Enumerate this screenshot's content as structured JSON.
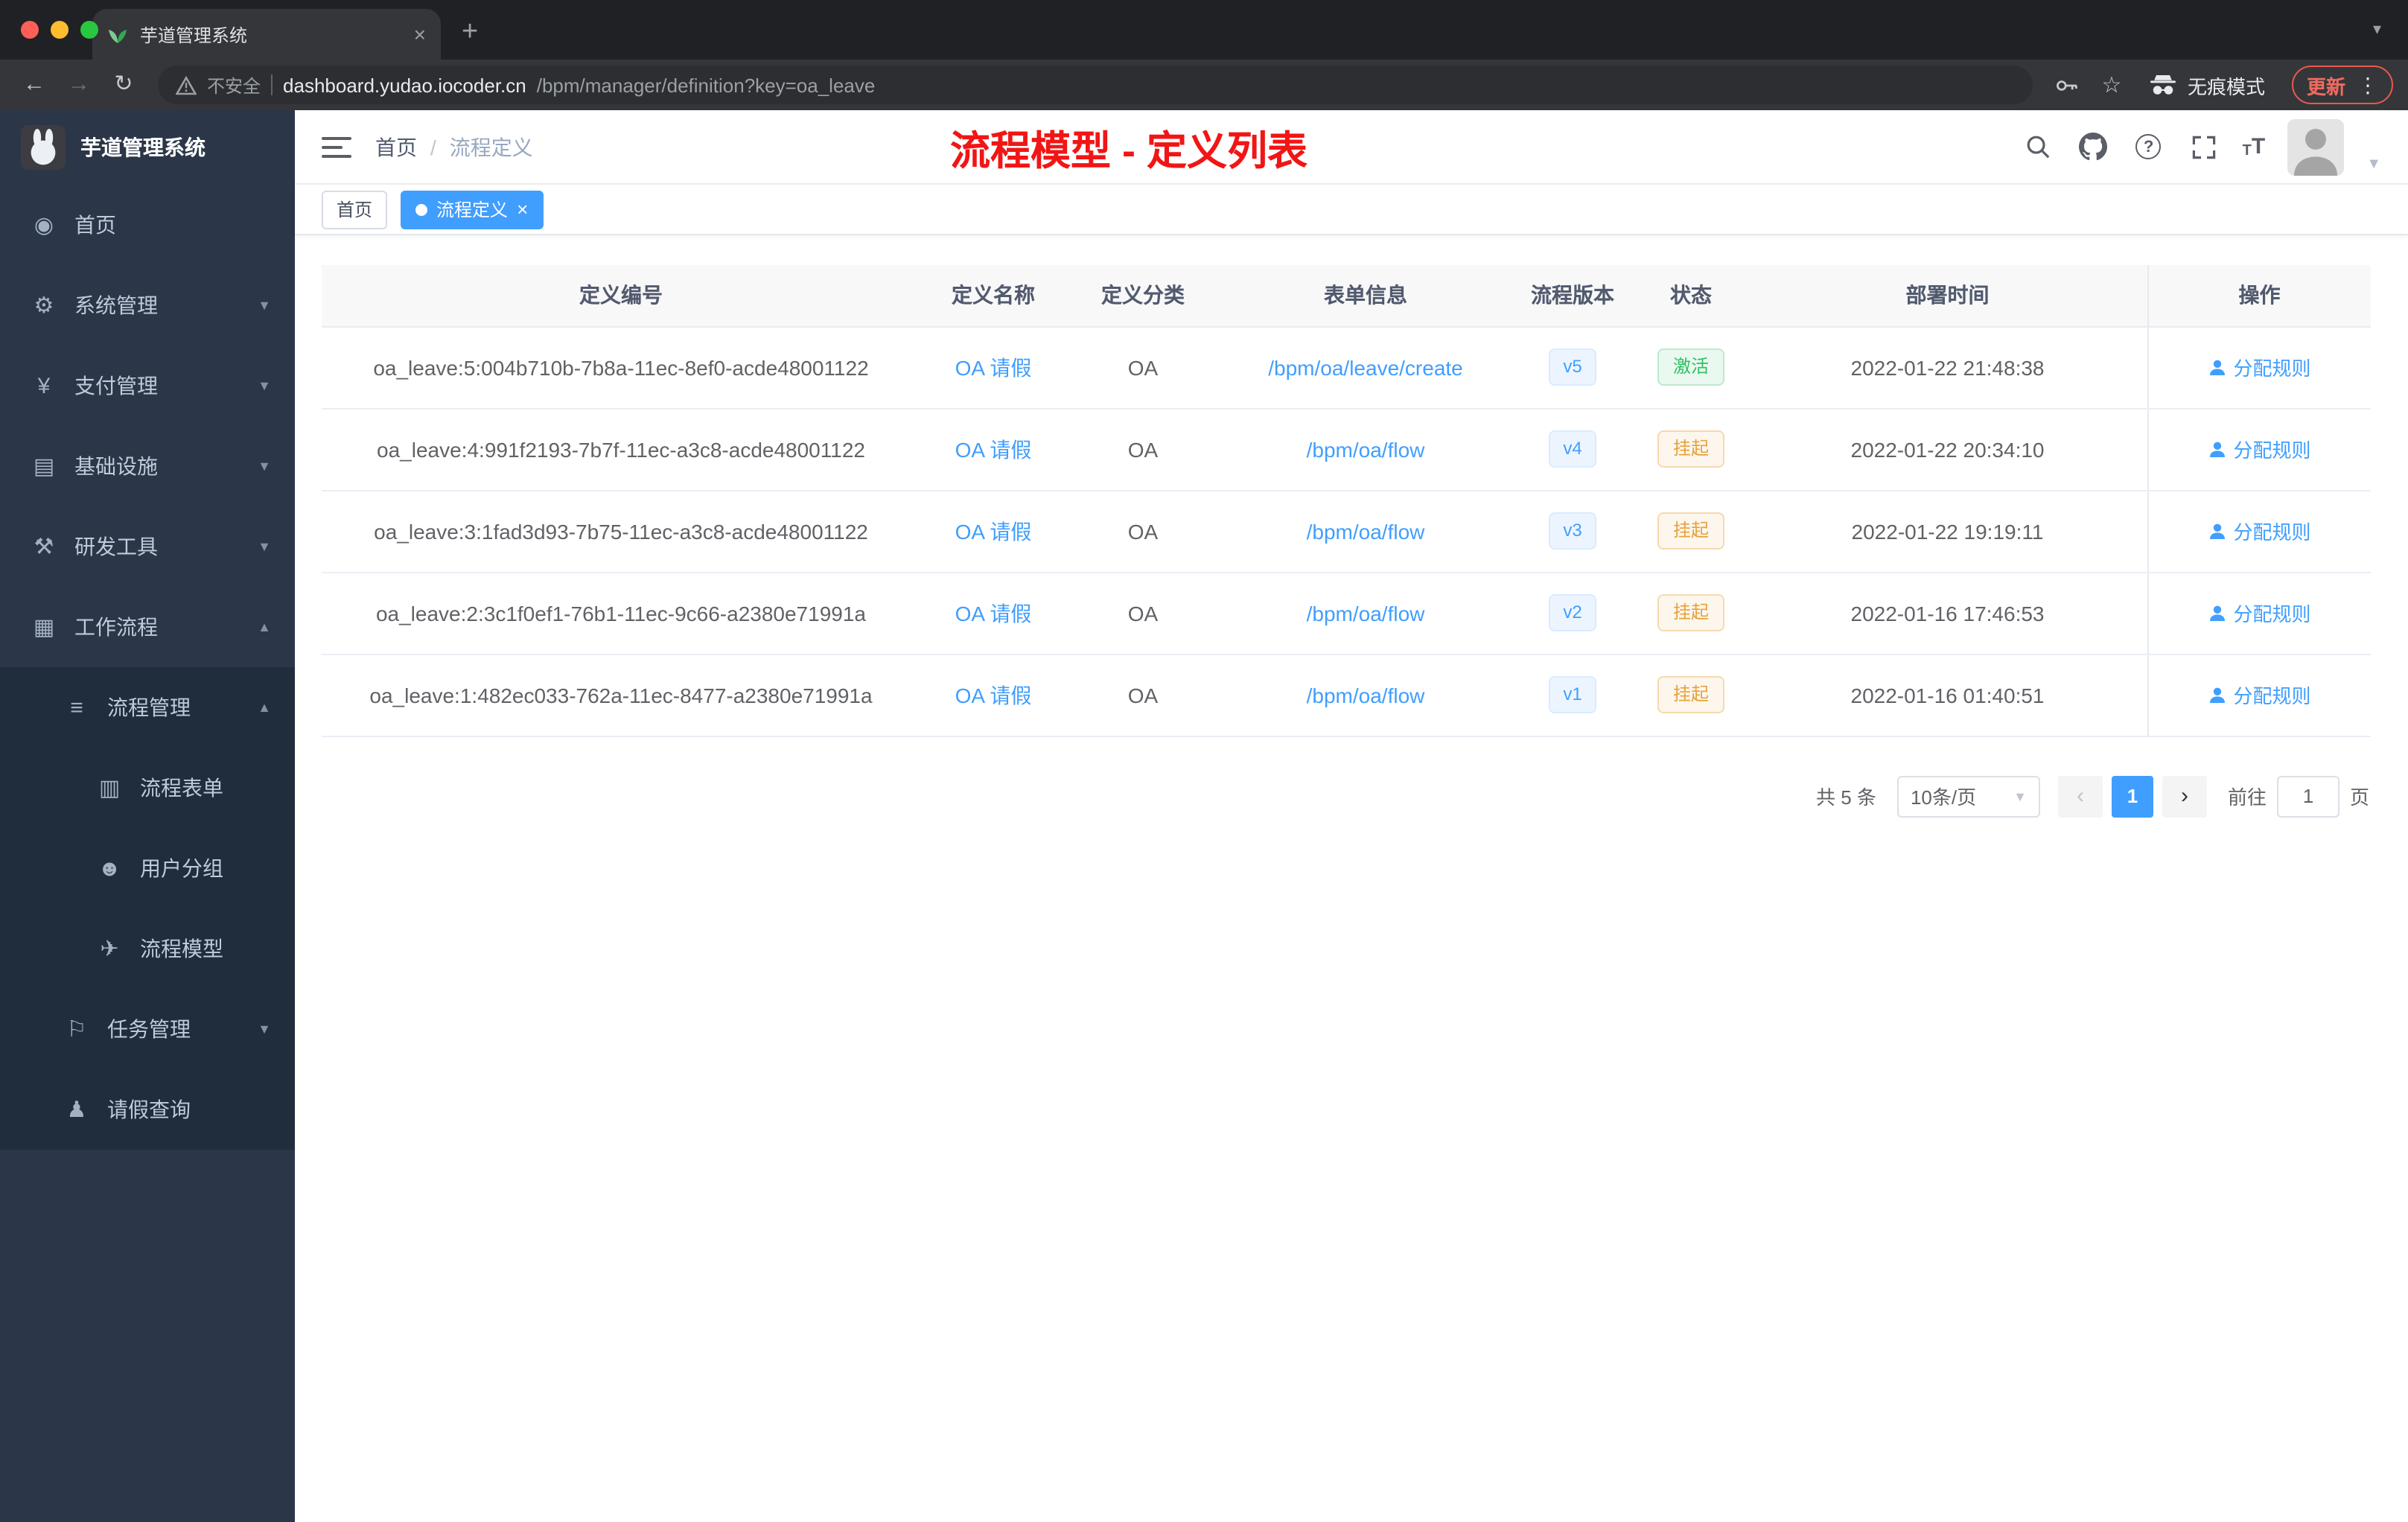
{
  "colors": {
    "accent": "#409eff",
    "title_red": "#f21515",
    "success": "#2fbf62",
    "warning": "#e6a23c",
    "sidebar_bg": "#2b3648",
    "submenu_bg": "#1f2d3d"
  },
  "browser": {
    "tab_title": "芋道管理系统",
    "security_label": "不安全",
    "url_domain": "dashboard.yudao.iocoder.cn",
    "url_path": "/bpm/manager/definition?key=oa_leave",
    "incognito_label": "无痕模式",
    "update_label": "更新"
  },
  "sidebar": {
    "logo_title": "芋道管理系统",
    "items": [
      {
        "label": "首页",
        "icon": "dashboard-icon",
        "glyph": "◉"
      },
      {
        "label": "系统管理",
        "icon": "gear-icon",
        "glyph": "⚙"
      },
      {
        "label": "支付管理",
        "icon": "yen-icon",
        "glyph": "¥"
      },
      {
        "label": "基础设施",
        "icon": "infrastructure-icon",
        "glyph": "▤"
      },
      {
        "label": "研发工具",
        "icon": "dev-tools-icon",
        "glyph": "⚒"
      },
      {
        "label": "工作流程",
        "icon": "workflow-icon",
        "glyph": "▦"
      },
      {
        "label": "流程管理",
        "icon": "process-list-icon",
        "glyph": "≡"
      },
      {
        "label": "流程表单",
        "icon": "form-icon",
        "glyph": "▥"
      },
      {
        "label": "用户分组",
        "icon": "user-group-icon",
        "glyph": "☻"
      },
      {
        "label": "流程模型",
        "icon": "model-send-icon",
        "glyph": "✈"
      },
      {
        "label": "任务管理",
        "icon": "task-flag-icon",
        "glyph": "⚐"
      },
      {
        "label": "请假查询",
        "icon": "person-icon",
        "glyph": "♟"
      }
    ]
  },
  "header": {
    "breadcrumb": {
      "home": "首页",
      "separator": "/",
      "current": "流程定义"
    },
    "overlay_title": "流程模型 - 定义列表"
  },
  "tags": [
    {
      "label": "首页"
    },
    {
      "label": "流程定义"
    }
  ],
  "table": {
    "columns": [
      "定义编号",
      "定义名称",
      "定义分类",
      "表单信息",
      "流程版本",
      "状态",
      "部署时间",
      "操作"
    ],
    "rows": [
      {
        "id": "oa_leave:5:004b710b-7b8a-11ec-8ef0-acde48001122",
        "name": "OA 请假",
        "category": "OA",
        "form": "/bpm/oa/leave/create",
        "version": "v5",
        "status": "激活",
        "time": "2022-01-22 21:48:38",
        "action": "分配规则"
      },
      {
        "id": "oa_leave:4:991f2193-7b7f-11ec-a3c8-acde48001122",
        "name": "OA 请假",
        "category": "OA",
        "form": "/bpm/oa/flow",
        "version": "v4",
        "status": "挂起",
        "time": "2022-01-22 20:34:10",
        "action": "分配规则"
      },
      {
        "id": "oa_leave:3:1fad3d93-7b75-11ec-a3c8-acde48001122",
        "name": "OA 请假",
        "category": "OA",
        "form": "/bpm/oa/flow",
        "version": "v3",
        "status": "挂起",
        "time": "2022-01-22 19:19:11",
        "action": "分配规则"
      },
      {
        "id": "oa_leave:2:3c1f0ef1-76b1-11ec-9c66-a2380e71991a",
        "name": "OA 请假",
        "category": "OA",
        "form": "/bpm/oa/flow",
        "version": "v2",
        "status": "挂起",
        "time": "2022-01-16 17:46:53",
        "action": "分配规则"
      },
      {
        "id": "oa_leave:1:482ec033-762a-11ec-8477-a2380e71991a",
        "name": "OA 请假",
        "category": "OA",
        "form": "/bpm/oa/flow",
        "version": "v1",
        "status": "挂起",
        "time": "2022-01-16 01:40:51",
        "action": "分配规则"
      }
    ]
  },
  "pagination": {
    "total": "共 5 条",
    "page_size": "10条/页",
    "current_page": "1",
    "goto_label": "前往",
    "goto_value": "1",
    "page_unit": "页"
  }
}
